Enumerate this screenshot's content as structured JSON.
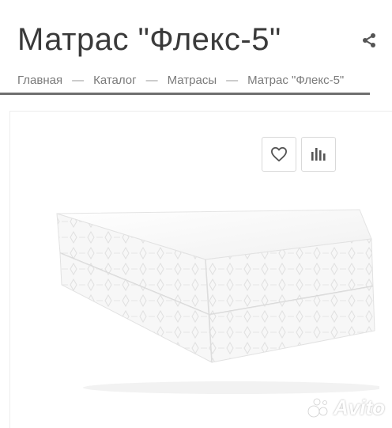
{
  "page": {
    "title": "Матрас \"Флекс-5\""
  },
  "breadcrumb": {
    "items": [
      "Главная",
      "Каталог",
      "Матрасы",
      "Матрас \"Флекс-5\""
    ],
    "separator": "—"
  },
  "icons": {
    "share": "share-icon",
    "favorite": "heart-icon",
    "compare": "bar-chart-icon"
  },
  "watermark": {
    "text": "Avito"
  },
  "colors": {
    "title": "#3a3a3a",
    "breadcrumb": "#7a7a7a",
    "rule": "#6f6f6f",
    "button_border": "#d9d9d9",
    "icon": "#555555"
  }
}
